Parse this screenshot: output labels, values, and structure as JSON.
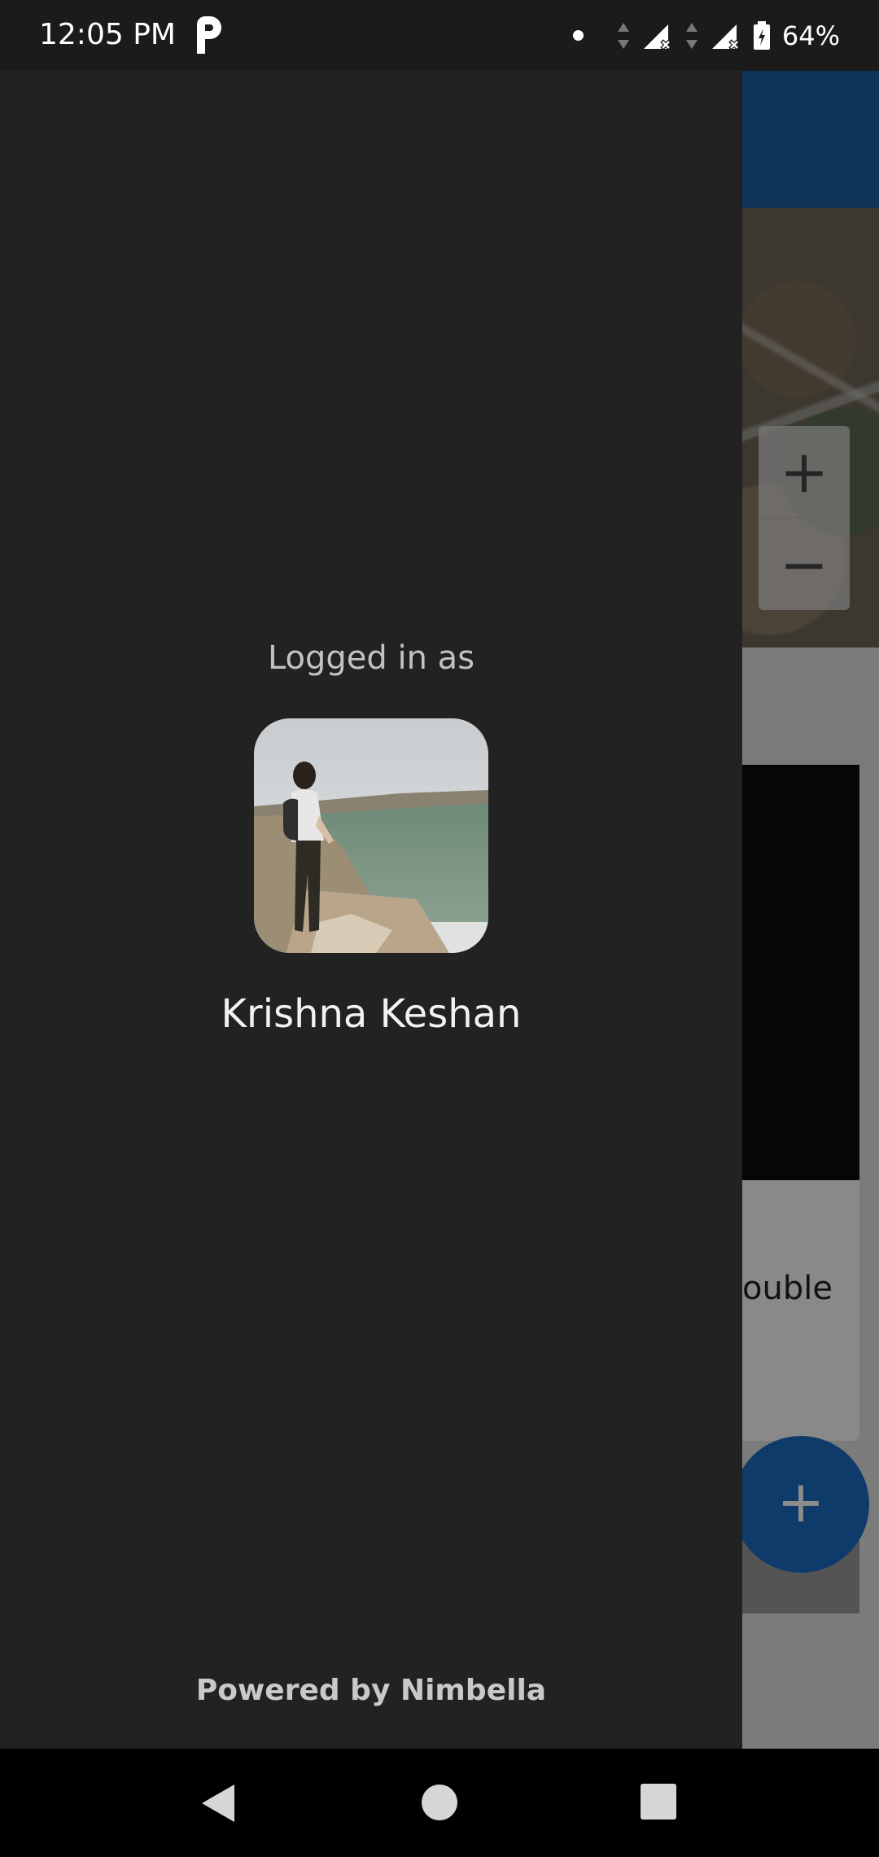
{
  "status_bar": {
    "time": "12:05 PM",
    "app_icon": "p-icon",
    "icons": [
      "notification-dot-icon",
      "data-arrows-icon",
      "signal-no-service-icon",
      "data-arrows-icon",
      "signal-no-service-icon",
      "battery-charging-icon"
    ],
    "battery_percent": "64%"
  },
  "drawer": {
    "logged_in_label": "Logged in as",
    "avatar": "profile-photo",
    "user_name": "Krishna Keshan",
    "footer": "Powered by Nimbella"
  },
  "background_app": {
    "zoom_in": "+",
    "zoom_out": "−",
    "card_text_fragment": "ouble",
    "fab_label": "+"
  },
  "nav_bar": {
    "buttons": [
      "back-icon",
      "home-icon",
      "recents-icon"
    ]
  },
  "colors": {
    "drawer_bg": "#222222",
    "header_blue": "#1a5fa1",
    "fab_blue": "#1c6cc4"
  }
}
